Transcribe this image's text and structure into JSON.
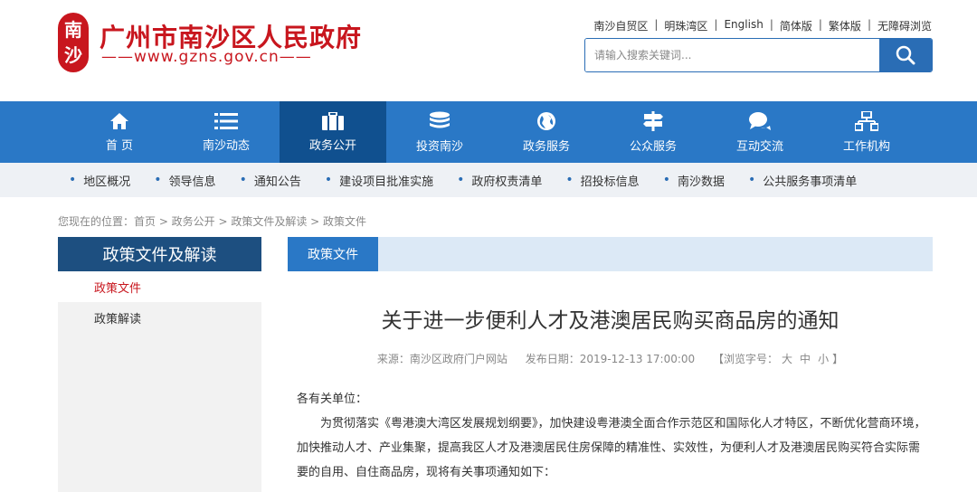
{
  "header": {
    "logo_glyphs": [
      "南",
      "沙"
    ],
    "site_title": "广州市南沙区人民政府",
    "site_url": "——www.gzns.gov.cn——",
    "top_links": [
      "南沙自贸区",
      "明珠湾区",
      "English",
      "简体版",
      "繁体版",
      "无障碍浏览"
    ],
    "top_links_sep": "|",
    "search_placeholder": "请输入搜索关键词..."
  },
  "nav": {
    "items": [
      {
        "label": "首 页",
        "icon": "home-icon"
      },
      {
        "label": "南沙动态",
        "icon": "list-icon"
      },
      {
        "label": "政务公开",
        "icon": "briefcase-icon",
        "active": true
      },
      {
        "label": "投资南沙",
        "icon": "coins-icon"
      },
      {
        "label": "政务服务",
        "icon": "globe-icon"
      },
      {
        "label": "公众服务",
        "icon": "signpost-icon"
      },
      {
        "label": "互动交流",
        "icon": "chat-icon"
      },
      {
        "label": "工作机构",
        "icon": "org-chart-icon"
      }
    ]
  },
  "subnav": {
    "items": [
      "地区概况",
      "领导信息",
      "通知公告",
      "建设项目批准实施",
      "政府权责清单",
      "招投标信息",
      "南沙数据",
      "公共服务事项清单"
    ]
  },
  "breadcrumb": "您现在的位置：首页 > 政务公开 > 政策文件及解读 > 政策文件",
  "sidebar": {
    "title": "政策文件及解读",
    "items": [
      {
        "label": "政策文件",
        "active": true
      },
      {
        "label": "政策解读",
        "active": false
      }
    ]
  },
  "content": {
    "tab_label": "政策文件",
    "title": "关于进一步便利人才及港澳居民购买商品房的通知",
    "meta": {
      "source": "来源：南沙区政府门户网站",
      "date": "发布日期：2019-12-13 17:00:00",
      "size_prefix": "【浏览字号：",
      "size_large": "大",
      "size_medium": "中",
      "size_small": "小",
      "size_suffix": "】"
    },
    "salutation": "各有关单位：",
    "paragraph": "为贯彻落实《粤港澳大湾区发展规划纲要》，加快建设粤港澳全面合作示范区和国际化人才特区，不断优化营商环境，加快推动人才、产业集聚，提高我区人才及港澳居民住房保障的精准性、实效性，为便利人才及港澳居民购买符合实际需要的自用、自住商品房，现将有关事项通知如下："
  },
  "colors": {
    "brand_red": "#c8161e",
    "nav_blue": "#2a78c6",
    "nav_active": "#10508f",
    "sidebar_title": "#1d4f80"
  }
}
